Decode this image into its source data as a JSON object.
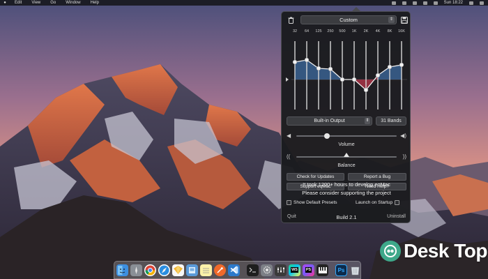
{
  "menubar": {
    "items": [
      "Edit",
      "View",
      "Go",
      "Window",
      "Help"
    ],
    "clock": "Sun 18:22"
  },
  "eqmac": {
    "preset": "Custom",
    "frequencies": [
      "32",
      "64",
      "125",
      "250",
      "500",
      "1K",
      "2K",
      "4K",
      "8K",
      "16K"
    ],
    "output_device": "Built-in Output",
    "bands": "31 Bands",
    "volume_label": "Volume",
    "balance_label": "Balance",
    "buttons": {
      "check_updates": "Check for Updates",
      "report_bug": "Report a Bug",
      "support": "Support eqMac",
      "need_help": "Need Help?"
    },
    "message_line1": "It took 1200+ hours to develop eqMac",
    "message_line2": "Please consider supporting the project",
    "show_default_presets": "Show Default Presets",
    "launch_on_startup": "Launch on Startup",
    "quit": "Quit",
    "build": "Build 2.1",
    "uninstall": "Uninstall",
    "colors": {
      "boost": "#3f6fa8",
      "cut": "#b0344a",
      "curve": "#f0f0f0"
    }
  },
  "dock": {
    "apps": [
      {
        "icon": "finder-icon",
        "color": "#3d8fe0"
      },
      {
        "icon": "launchpad-icon",
        "color": "#8a8f96"
      },
      {
        "icon": "chrome-icon",
        "color": "#d94a3a"
      },
      {
        "icon": "safari-icon",
        "color": "#2a8de0"
      },
      {
        "icon": "sketch-icon",
        "color": "#f2b431"
      },
      {
        "icon": "preview-icon",
        "color": "#5a9ad8"
      },
      {
        "icon": "notes-icon",
        "color": "#f5e27a"
      },
      {
        "icon": "postman-icon",
        "color": "#f06a2a"
      },
      {
        "icon": "vscode-icon",
        "color": "#2c7acb"
      },
      {
        "icon": "terminal-icon",
        "color": "#2a2a2a"
      },
      {
        "icon": "system-preferences-icon",
        "color": "#7c7f86"
      },
      {
        "icon": "eqmac-icon",
        "color": "#3a3a3a"
      },
      {
        "icon": "webstorm-icon",
        "color": "#1f1f22"
      },
      {
        "icon": "phpstorm-icon",
        "color": "#6d3fd1"
      },
      {
        "icon": "piano-icon",
        "color": "#222222"
      },
      {
        "icon": "photoshop-icon",
        "color": "#0c2a4a"
      },
      {
        "icon": "trash-icon",
        "color": "#a9aeb5"
      }
    ],
    "labels": {
      "ws": "WS",
      "ps_storm": "PS",
      "ps": "Ps"
    }
  },
  "watermark": {
    "text": "Desk Top"
  }
}
